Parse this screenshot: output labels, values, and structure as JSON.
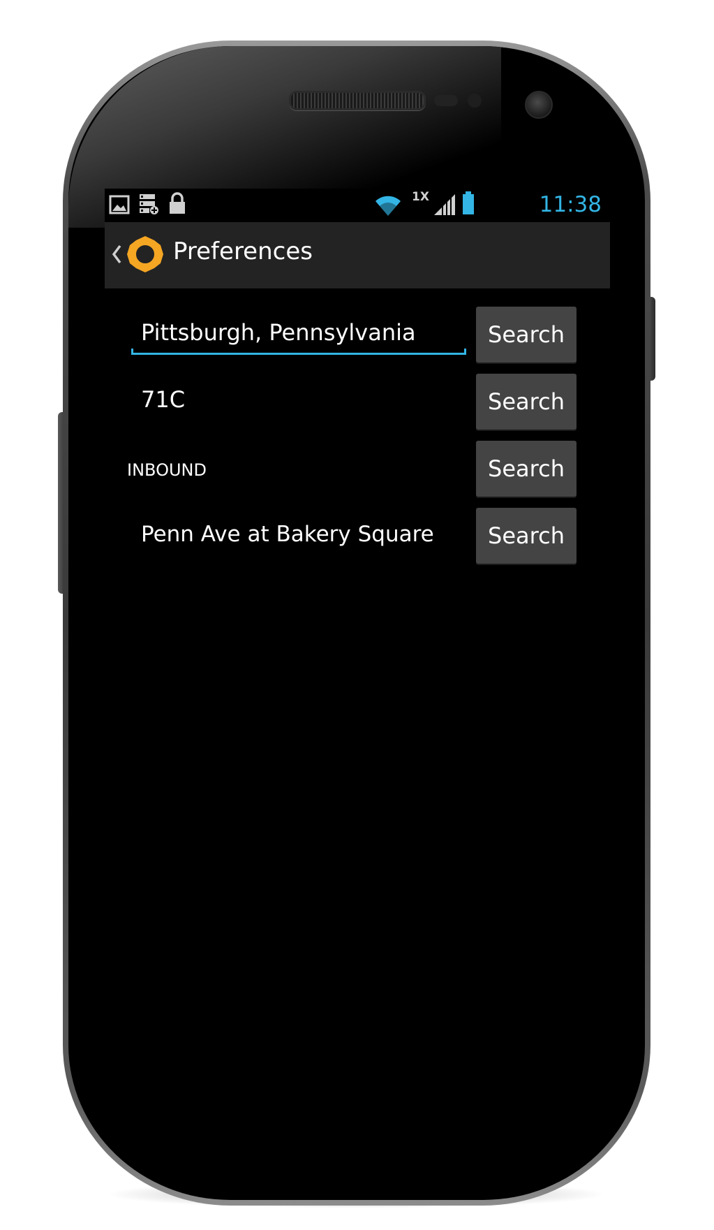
{
  "status_bar": {
    "time": "11:38",
    "network_label": "1X",
    "accent_color": "#33b5e5",
    "left_icons": [
      "image-icon",
      "storage-icon",
      "lock-icon"
    ],
    "right_icons": [
      "wifi-icon",
      "signal-icon",
      "battery-icon"
    ]
  },
  "action_bar": {
    "title": "Preferences",
    "up_icon": "chevron-left-icon",
    "app_icon": "sun-gear-icon",
    "app_icon_color": "#f5a623"
  },
  "form": {
    "location": {
      "value": "Pittsburgh, Pennsylvania",
      "button_label": "Search"
    },
    "route": {
      "value": "71C",
      "button_label": "Search"
    },
    "direction": {
      "value": "INBOUND",
      "button_label": "Search"
    },
    "stop": {
      "value": "Penn Ave at Bakery Square",
      "button_label": "Search"
    }
  }
}
